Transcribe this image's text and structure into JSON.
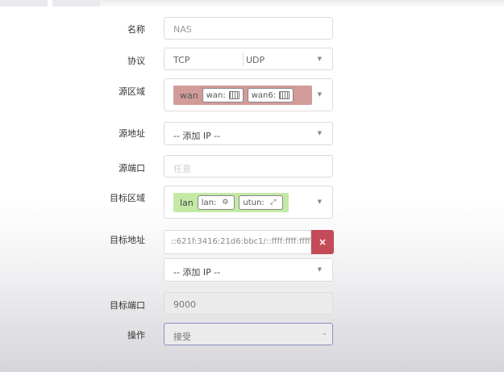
{
  "form": {
    "name": {
      "label": "名称",
      "value": "NAS"
    },
    "protocol": {
      "label": "协议",
      "options": [
        "TCP",
        "UDP"
      ]
    },
    "src_zone": {
      "label": "源区域",
      "zone": "wan",
      "devices": [
        {
          "name": "wan:",
          "icon": "network-icon"
        },
        {
          "name": "wan6:",
          "icon": "network-icon"
        }
      ]
    },
    "src_address": {
      "label": "源地址",
      "value": "-- 添加 IP --"
    },
    "src_port": {
      "label": "源端口",
      "placeholder": "任意"
    },
    "dest_zone": {
      "label": "目标区域",
      "zone": "lan",
      "devices": [
        {
          "name": "lan:",
          "icon": "bridge-icon"
        },
        {
          "name": "utun:",
          "icon": "tunnel-icon"
        }
      ]
    },
    "dest_address": {
      "label": "目标地址",
      "value": "::621f:3416:21d6:bbc1/::ffff:ffff:ffff:...",
      "remove": "×",
      "add": "-- 添加 IP --"
    },
    "dest_port": {
      "label": "目标端口",
      "value": "9000"
    },
    "action": {
      "label": "操作",
      "value": "接受"
    }
  },
  "colors": {
    "wan_zone": "#d19b99",
    "lan_zone": "#c4e9a5",
    "remove_button": "#c54a58"
  }
}
